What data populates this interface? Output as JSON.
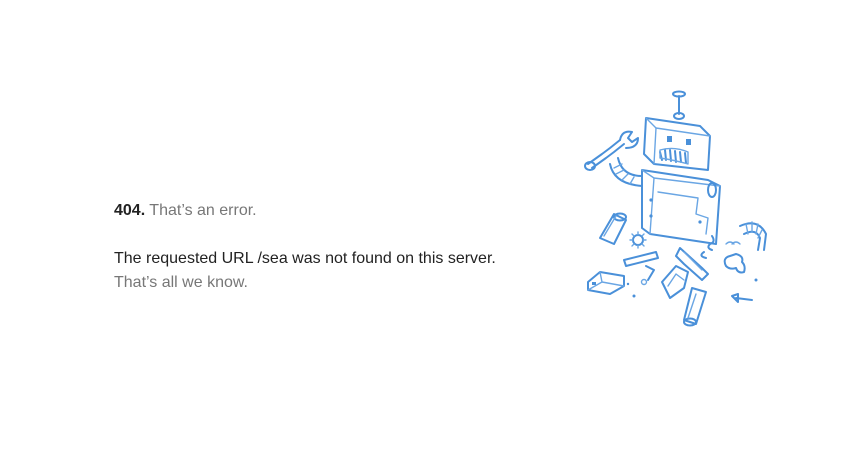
{
  "error": {
    "code": "404.",
    "title": "That’s an error.",
    "detail": "The requested URL /sea was not found on this server.",
    "footnote": "That’s all we know."
  },
  "illustration": {
    "icon": "broken-robot-icon",
    "color": "#4a90d9"
  },
  "colors": {
    "text_primary": "#222222",
    "text_secondary": "#777777",
    "background": "#ffffff"
  }
}
